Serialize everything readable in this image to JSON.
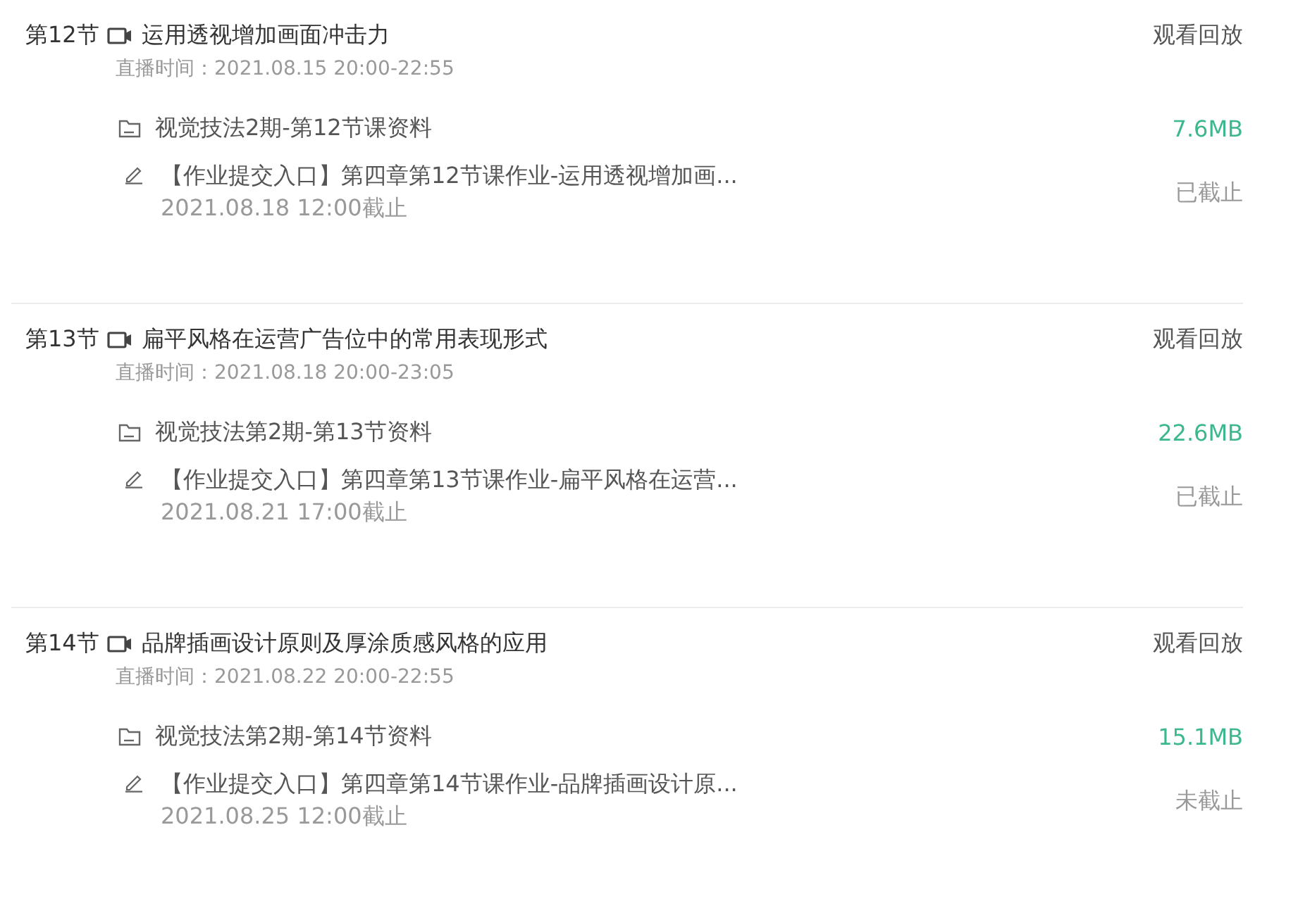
{
  "lessons": [
    {
      "number": "第12节",
      "title": "运用透视增加画面冲击力",
      "replay": "观看回放",
      "live_time": "直播时间：2021.08.15 20:00-22:55",
      "material": {
        "name": "视觉技法2期-第12节课资料",
        "size": "7.6MB"
      },
      "homework": {
        "title": "【作业提交入口】第四章第12节课作业-运用透视增加画...",
        "deadline": "2021.08.18 12:00截止",
        "status": "已截止"
      }
    },
    {
      "number": "第13节",
      "title": "扁平风格在运营广告位中的常用表现形式",
      "replay": "观看回放",
      "live_time": "直播时间：2021.08.18 20:00-23:05",
      "material": {
        "name": "视觉技法第2期-第13节资料",
        "size": "22.6MB"
      },
      "homework": {
        "title": "【作业提交入口】第四章第13节课作业-扁平风格在运营...",
        "deadline": "2021.08.21 17:00截止",
        "status": "已截止"
      }
    },
    {
      "number": "第14节",
      "title": "品牌插画设计原则及厚涂质感风格的应用",
      "replay": "观看回放",
      "live_time": "直播时间：2021.08.22 20:00-22:55",
      "material": {
        "name": "视觉技法第2期-第14节资料",
        "size": "15.1MB"
      },
      "homework": {
        "title": "【作业提交入口】第四章第14节课作业-品牌插画设计原...",
        "deadline": "2021.08.25 12:00截止",
        "status": "未截止"
      }
    }
  ]
}
